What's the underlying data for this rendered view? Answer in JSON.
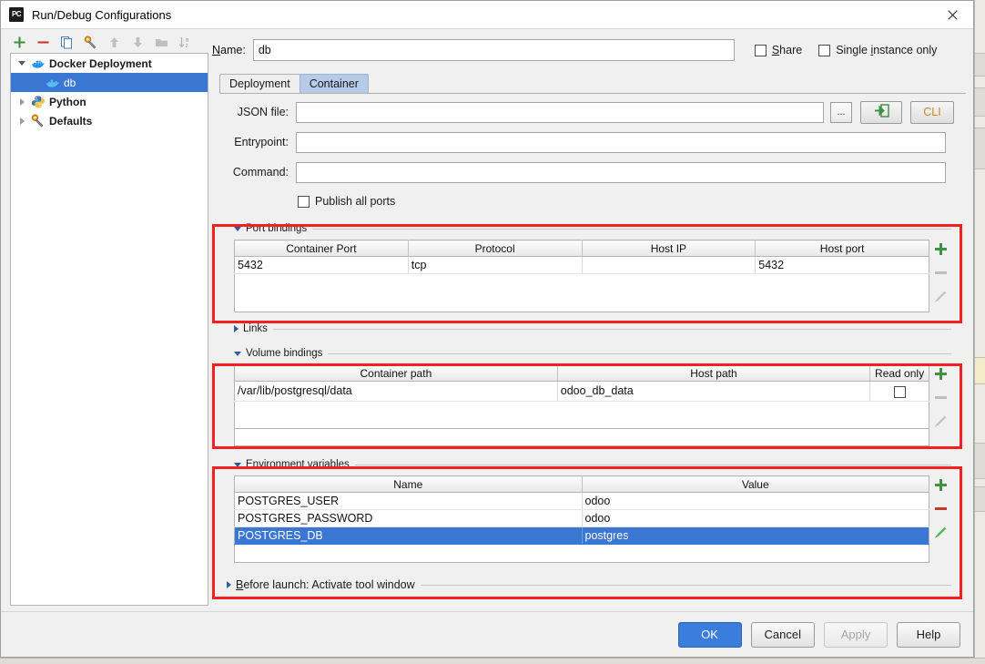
{
  "window": {
    "title": "Run/Debug Configurations",
    "app_icon": "pycharm-icon",
    "app_icon_text": "PC",
    "close_icon": "close-icon"
  },
  "toolbar": {
    "buttons": [
      {
        "name": "add-configuration-button",
        "icon": "plus-icon",
        "enabled": true
      },
      {
        "name": "remove-configuration-button",
        "icon": "minus-icon",
        "enabled": true
      },
      {
        "name": "copy-configuration-button",
        "icon": "copy-icon",
        "enabled": true
      },
      {
        "name": "edit-defaults-button",
        "icon": "wrench-icon",
        "enabled": true
      },
      {
        "name": "move-up-button",
        "icon": "arrow-up-icon",
        "enabled": false
      },
      {
        "name": "move-down-button",
        "icon": "arrow-down-icon",
        "enabled": false
      },
      {
        "name": "new-folder-button",
        "icon": "folder-icon",
        "enabled": false
      },
      {
        "name": "sort-alphabetically-button",
        "icon": "sort-az-icon",
        "enabled": false
      }
    ]
  },
  "tree": {
    "items": [
      {
        "label": "Docker Deployment",
        "icon": "docker-icon",
        "expanded": true,
        "indent": 0,
        "selected": false,
        "bold": true,
        "has_twisty": true
      },
      {
        "label": "db",
        "icon": "docker-icon",
        "expanded": false,
        "indent": 1,
        "selected": true,
        "bold": false,
        "has_twisty": false
      },
      {
        "label": "Python",
        "icon": "python-icon",
        "expanded": false,
        "indent": 0,
        "selected": false,
        "bold": true,
        "has_twisty": true
      },
      {
        "label": "Defaults",
        "icon": "wrench-icon",
        "expanded": false,
        "indent": 0,
        "selected": false,
        "bold": true,
        "has_twisty": true
      }
    ]
  },
  "name_row": {
    "label": "Name:",
    "label_mnemonic": "N",
    "value": "db",
    "share_label": "Share",
    "share_mnemonic": "S",
    "share_checked": false,
    "single_instance_label": "Single instance only",
    "single_instance_mnemonic": "i",
    "single_instance_checked": false
  },
  "tabs": [
    {
      "label": "Deployment",
      "active": false
    },
    {
      "label": "Container",
      "active": true
    }
  ],
  "container_tab": {
    "json_file": {
      "label": "JSON file:",
      "value": "",
      "browse_label": "...",
      "import_icon": "import-arrow-icon",
      "cli_label": "CLI"
    },
    "entrypoint": {
      "label": "Entrypoint:",
      "value": ""
    },
    "command": {
      "label": "Command:",
      "value": ""
    },
    "publish_all_ports": {
      "label": "Publish all ports",
      "checked": false
    }
  },
  "sections": {
    "port_bindings": {
      "title": "Port bindings",
      "expanded": true,
      "highlighted": true,
      "columns": [
        "Container Port",
        "Protocol",
        "Host IP",
        "Host port"
      ],
      "rows": [
        {
          "cells": [
            "5432",
            "tcp",
            "",
            "5432"
          ],
          "selected": false
        }
      ],
      "buttons": [
        {
          "name": "add-port-binding-button",
          "icon": "plus-icon",
          "enabled": true
        },
        {
          "name": "remove-port-binding-button",
          "icon": "minus-icon",
          "enabled": false
        },
        {
          "name": "edit-port-binding-button",
          "icon": "pencil-icon",
          "enabled": false
        }
      ]
    },
    "links": {
      "title": "Links",
      "expanded": false,
      "highlighted": false
    },
    "volume_bindings": {
      "title": "Volume bindings",
      "expanded": true,
      "highlighted": true,
      "columns": [
        "Container path",
        "Host path",
        "Read only"
      ],
      "rows": [
        {
          "cells": [
            "/var/lib/postgresql/data",
            "odoo_db_data",
            ""
          ],
          "read_only_checked": false,
          "selected": false
        }
      ],
      "buttons": [
        {
          "name": "add-volume-binding-button",
          "icon": "plus-icon",
          "enabled": true
        },
        {
          "name": "remove-volume-binding-button",
          "icon": "minus-icon",
          "enabled": false
        },
        {
          "name": "edit-volume-binding-button",
          "icon": "pencil-icon",
          "enabled": false
        }
      ]
    },
    "environment_variables": {
      "title": "Environment variables",
      "expanded": true,
      "highlighted": true,
      "columns": [
        "Name",
        "Value"
      ],
      "rows": [
        {
          "cells": [
            "POSTGRES_USER",
            "odoo"
          ],
          "selected": false
        },
        {
          "cells": [
            "POSTGRES_PASSWORD",
            "odoo"
          ],
          "selected": false
        },
        {
          "cells": [
            "POSTGRES_DB",
            "postgres"
          ],
          "selected": true
        }
      ],
      "buttons": [
        {
          "name": "add-environment-variable-button",
          "icon": "plus-icon",
          "enabled": true
        },
        {
          "name": "remove-environment-variable-button",
          "icon": "minus-icon",
          "enabled": true
        },
        {
          "name": "edit-environment-variable-button",
          "icon": "pencil-icon",
          "enabled": true
        }
      ]
    }
  },
  "before_launch": {
    "title": "Before launch: Activate tool window",
    "mnemonic": "B",
    "expanded": false
  },
  "dialog_buttons": [
    {
      "label": "OK",
      "style": "primary",
      "enabled": true
    },
    {
      "label": "Cancel",
      "style": "normal",
      "enabled": true
    },
    {
      "label": "Apply",
      "style": "normal",
      "enabled": false
    },
    {
      "label": "Help",
      "style": "normal",
      "enabled": true
    }
  ],
  "colors": {
    "accent_blue": "#3a77d3",
    "primary_button": "#3a7ddc",
    "annotation_red": "#f42020",
    "add_green": "#3d9140",
    "remove_red": "#c0392b",
    "tab_active": "#b5cbe8"
  }
}
